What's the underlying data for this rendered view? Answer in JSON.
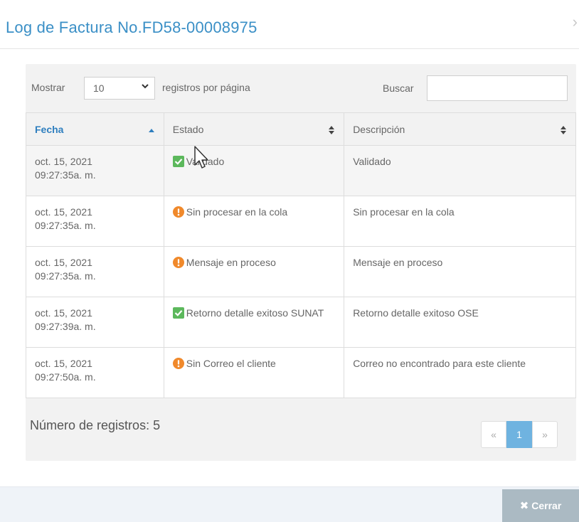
{
  "modal": {
    "title": "Log de Factura No.FD58-00008975",
    "close_symbol": "›"
  },
  "controls": {
    "show_label": "Mostrar",
    "page_size": "10",
    "per_page_label": "registros por página",
    "search_label": "Buscar",
    "search_value": ""
  },
  "table": {
    "columns": [
      "Fecha",
      "Estado",
      "Descripción"
    ],
    "rows": [
      {
        "date": "oct. 15, 2021",
        "time": "09:27:35a. m.",
        "status": "Validado",
        "status_icon": "check-icon",
        "description": "Validado"
      },
      {
        "date": "oct. 15, 2021",
        "time": "09:27:35a. m.",
        "status": "Sin procesar en la cola",
        "status_icon": "exclamation-icon",
        "description": "Sin procesar en la cola"
      },
      {
        "date": "oct. 15, 2021",
        "time": "09:27:35a. m.",
        "status": "Mensaje en proceso",
        "status_icon": "exclamation-icon",
        "description": "Mensaje en proceso"
      },
      {
        "date": "oct. 15, 2021",
        "time": "09:27:39a. m.",
        "status": "Retorno detalle exitoso SUNAT",
        "status_icon": "check-icon",
        "description": "Retorno detalle exitoso OSE"
      },
      {
        "date": "oct. 15, 2021",
        "time": "09:27:50a. m.",
        "status": "Sin Correo el cliente",
        "status_icon": "exclamation-icon",
        "description": "Correo no encontrado para este cliente"
      }
    ]
  },
  "footer": {
    "record_count_label": "Número de registros: 5"
  },
  "pagination": {
    "prev": "«",
    "current": "1",
    "next": "»"
  },
  "buttons": {
    "close_label": "Cerrar",
    "close_icon": "✖"
  },
  "colors": {
    "title": "#3a8fc6",
    "success": "#5cb85c",
    "warning": "#f0892b",
    "page_active": "#6fb3e0",
    "close_button": "#abbac3"
  }
}
